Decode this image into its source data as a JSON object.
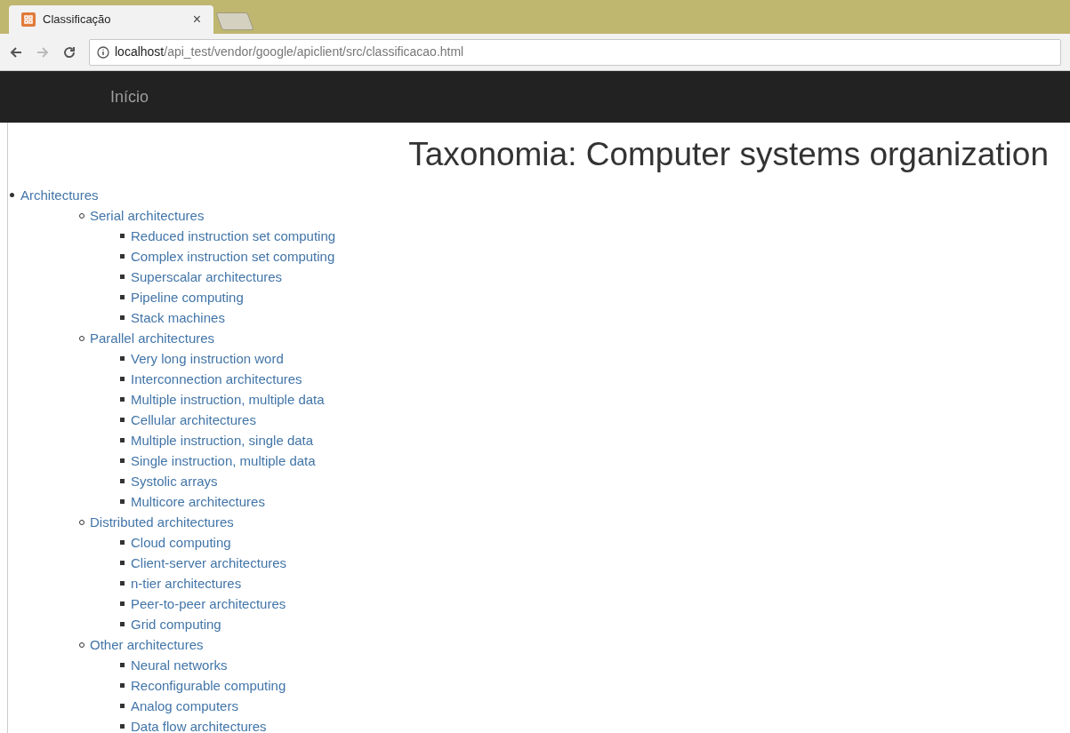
{
  "browser": {
    "tab": {
      "title": "Classificação",
      "close": "×"
    },
    "address": {
      "host": "localhost",
      "path": "/api_test/vendor/google/apiclient/src/classificacao.html"
    }
  },
  "navbar": {
    "brand": "Início"
  },
  "heading": "Taxonomia: Computer systems organization",
  "tree": [
    {
      "label": "Architectures",
      "children": [
        {
          "label": "Serial architectures",
          "children": [
            {
              "label": "Reduced instruction set computing"
            },
            {
              "label": "Complex instruction set computing"
            },
            {
              "label": "Superscalar architectures"
            },
            {
              "label": "Pipeline computing"
            },
            {
              "label": "Stack machines"
            }
          ]
        },
        {
          "label": "Parallel architectures",
          "children": [
            {
              "label": "Very long instruction word"
            },
            {
              "label": "Interconnection architectures"
            },
            {
              "label": "Multiple instruction, multiple data"
            },
            {
              "label": "Cellular architectures"
            },
            {
              "label": "Multiple instruction, single data"
            },
            {
              "label": "Single instruction, multiple data"
            },
            {
              "label": "Systolic arrays"
            },
            {
              "label": "Multicore architectures"
            }
          ]
        },
        {
          "label": "Distributed architectures",
          "children": [
            {
              "label": "Cloud computing"
            },
            {
              "label": "Client-server architectures"
            },
            {
              "label": "n-tier architectures"
            },
            {
              "label": "Peer-to-peer architectures"
            },
            {
              "label": "Grid computing"
            }
          ]
        },
        {
          "label": "Other architectures",
          "children": [
            {
              "label": "Neural networks"
            },
            {
              "label": "Reconfigurable computing"
            },
            {
              "label": "Analog computers"
            },
            {
              "label": "Data flow architectures"
            }
          ]
        }
      ]
    }
  ]
}
